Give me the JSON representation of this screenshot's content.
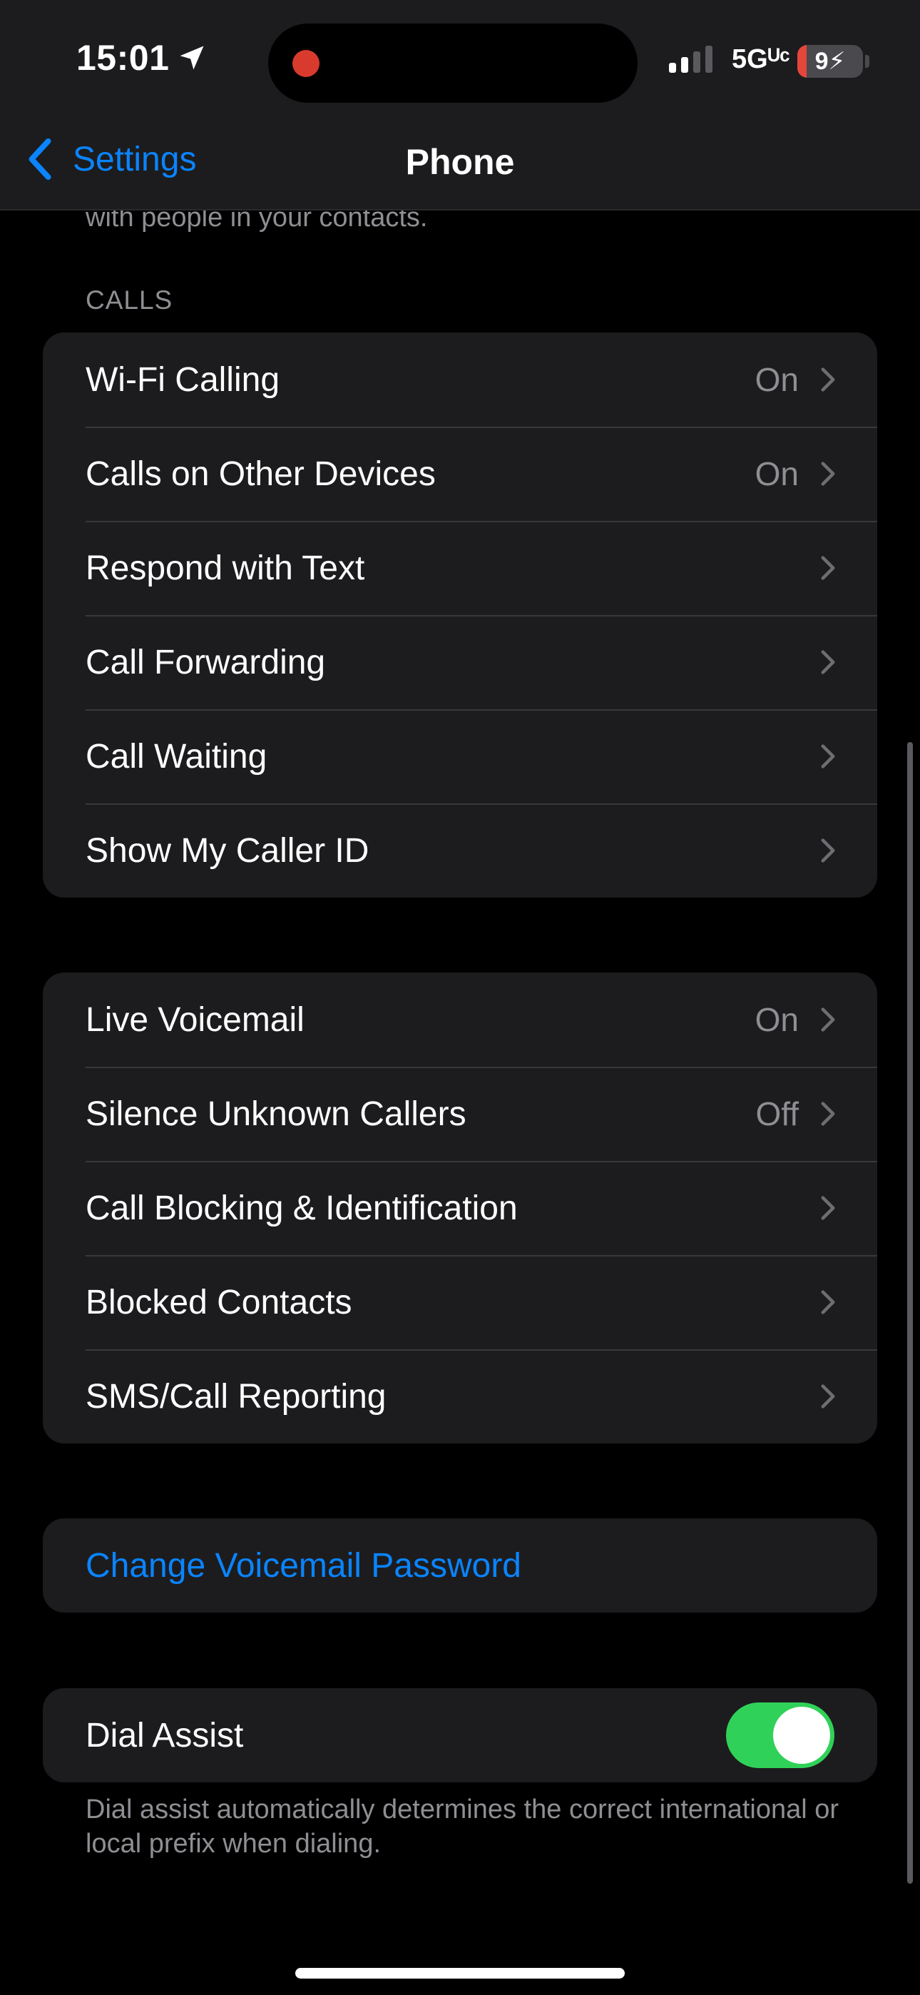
{
  "status_bar": {
    "time": "15:01",
    "network": "5Gᵁᶜ",
    "battery": "9",
    "battery_level_percent": 9,
    "recording_color": "#d93a2e"
  },
  "nav": {
    "back_label": "Settings",
    "title": "Phone"
  },
  "clipped_text": "with people in your contacts.",
  "calls_section": {
    "header": "CALLS",
    "rows": [
      {
        "label": "Wi-Fi Calling",
        "value": "On"
      },
      {
        "label": "Calls on Other Devices",
        "value": "On"
      },
      {
        "label": "Respond with Text",
        "value": ""
      },
      {
        "label": "Call Forwarding",
        "value": ""
      },
      {
        "label": "Call Waiting",
        "value": ""
      },
      {
        "label": "Show My Caller ID",
        "value": ""
      }
    ]
  },
  "voicemail_section": {
    "rows": [
      {
        "label": "Live Voicemail",
        "value": "On"
      },
      {
        "label": "Silence Unknown Callers",
        "value": "Off"
      },
      {
        "label": "Call Blocking & Identification",
        "value": ""
      },
      {
        "label": "Blocked Contacts",
        "value": ""
      },
      {
        "label": "SMS/Call Reporting",
        "value": ""
      }
    ]
  },
  "change_voicemail_password": "Change Voicemail Password",
  "dial_assist": {
    "label": "Dial Assist",
    "enabled": true,
    "footer": "Dial assist automatically determines the correct international or local prefix when dialing."
  },
  "colors": {
    "accent": "#0a84ff",
    "toggle_on": "#30d158",
    "cell_bg": "#1c1c1e",
    "secondary_text": "#8e8e93"
  }
}
